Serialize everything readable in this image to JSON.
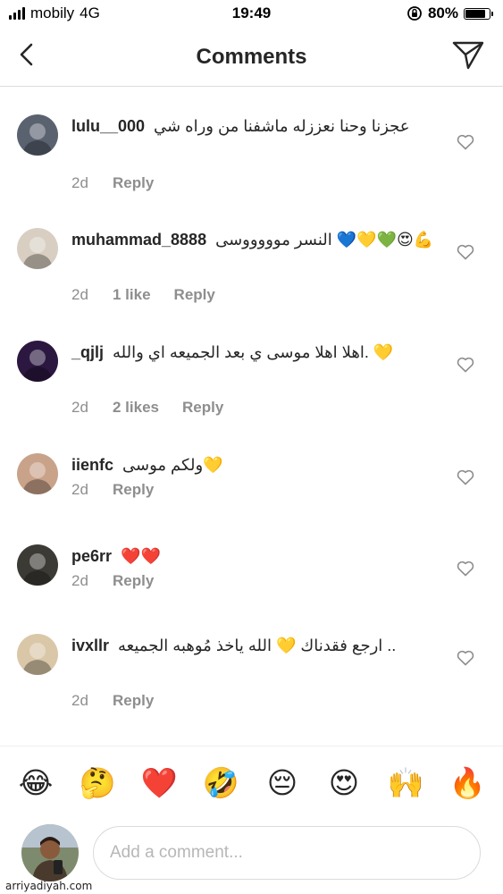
{
  "status_bar": {
    "carrier": "mobily",
    "network": "4G",
    "time": "19:49",
    "battery": "80%",
    "battery_level": 0.8
  },
  "header": {
    "title": "Comments",
    "back_icon": "chevron-left-icon",
    "share_icon": "paper-plane-icon"
  },
  "comments": [
    {
      "username": "lulu__000",
      "text": "عجزنا وحنا نعززله ماشفنا من وراه شي",
      "time": "2d",
      "likes": "",
      "reply": "Reply",
      "avatar_color": "#5a6270"
    },
    {
      "username": "muhammad_8888",
      "text": "النسر موووووسى 💙💛💚😍💪",
      "time": "2d",
      "likes": "1 like",
      "reply": "Reply",
      "avatar_color": "#d8cfc2"
    },
    {
      "username": "_qjlj",
      "text": "اهلا اهلا  موسى ي بعد الجميعه اي والله. 💛",
      "time": "2d",
      "likes": "2 likes",
      "reply": "Reply",
      "avatar_color": "#2b1740"
    },
    {
      "username": "iienfc",
      "text": "ولكم موسى💛",
      "time": "2d",
      "likes": "",
      "reply": "Reply",
      "avatar_color": "#c9a28a"
    },
    {
      "username": "pe6rr",
      "text": "❤️❤️",
      "time": "2d",
      "likes": "",
      "reply": "Reply",
      "avatar_color": "#3c3a35"
    },
    {
      "username": "ivxllr",
      "text": "ارجع فقدناك 💛 الله ياخذ مُوهبه الجميعه ..",
      "time": "2d",
      "likes": "",
      "reply": "Reply",
      "avatar_color": "#d9c7a8"
    }
  ],
  "emoji_bar": [
    "😂",
    "🤔",
    "❤️",
    "🤣",
    "😔",
    "😍",
    "🙌",
    "🔥"
  ],
  "input": {
    "placeholder": "Add a comment...",
    "value": ""
  },
  "watermark": "arriyadiyah.com",
  "colors": {
    "text": "#262626",
    "meta": "#8e8e8e",
    "divider": "#dbdbdb"
  }
}
